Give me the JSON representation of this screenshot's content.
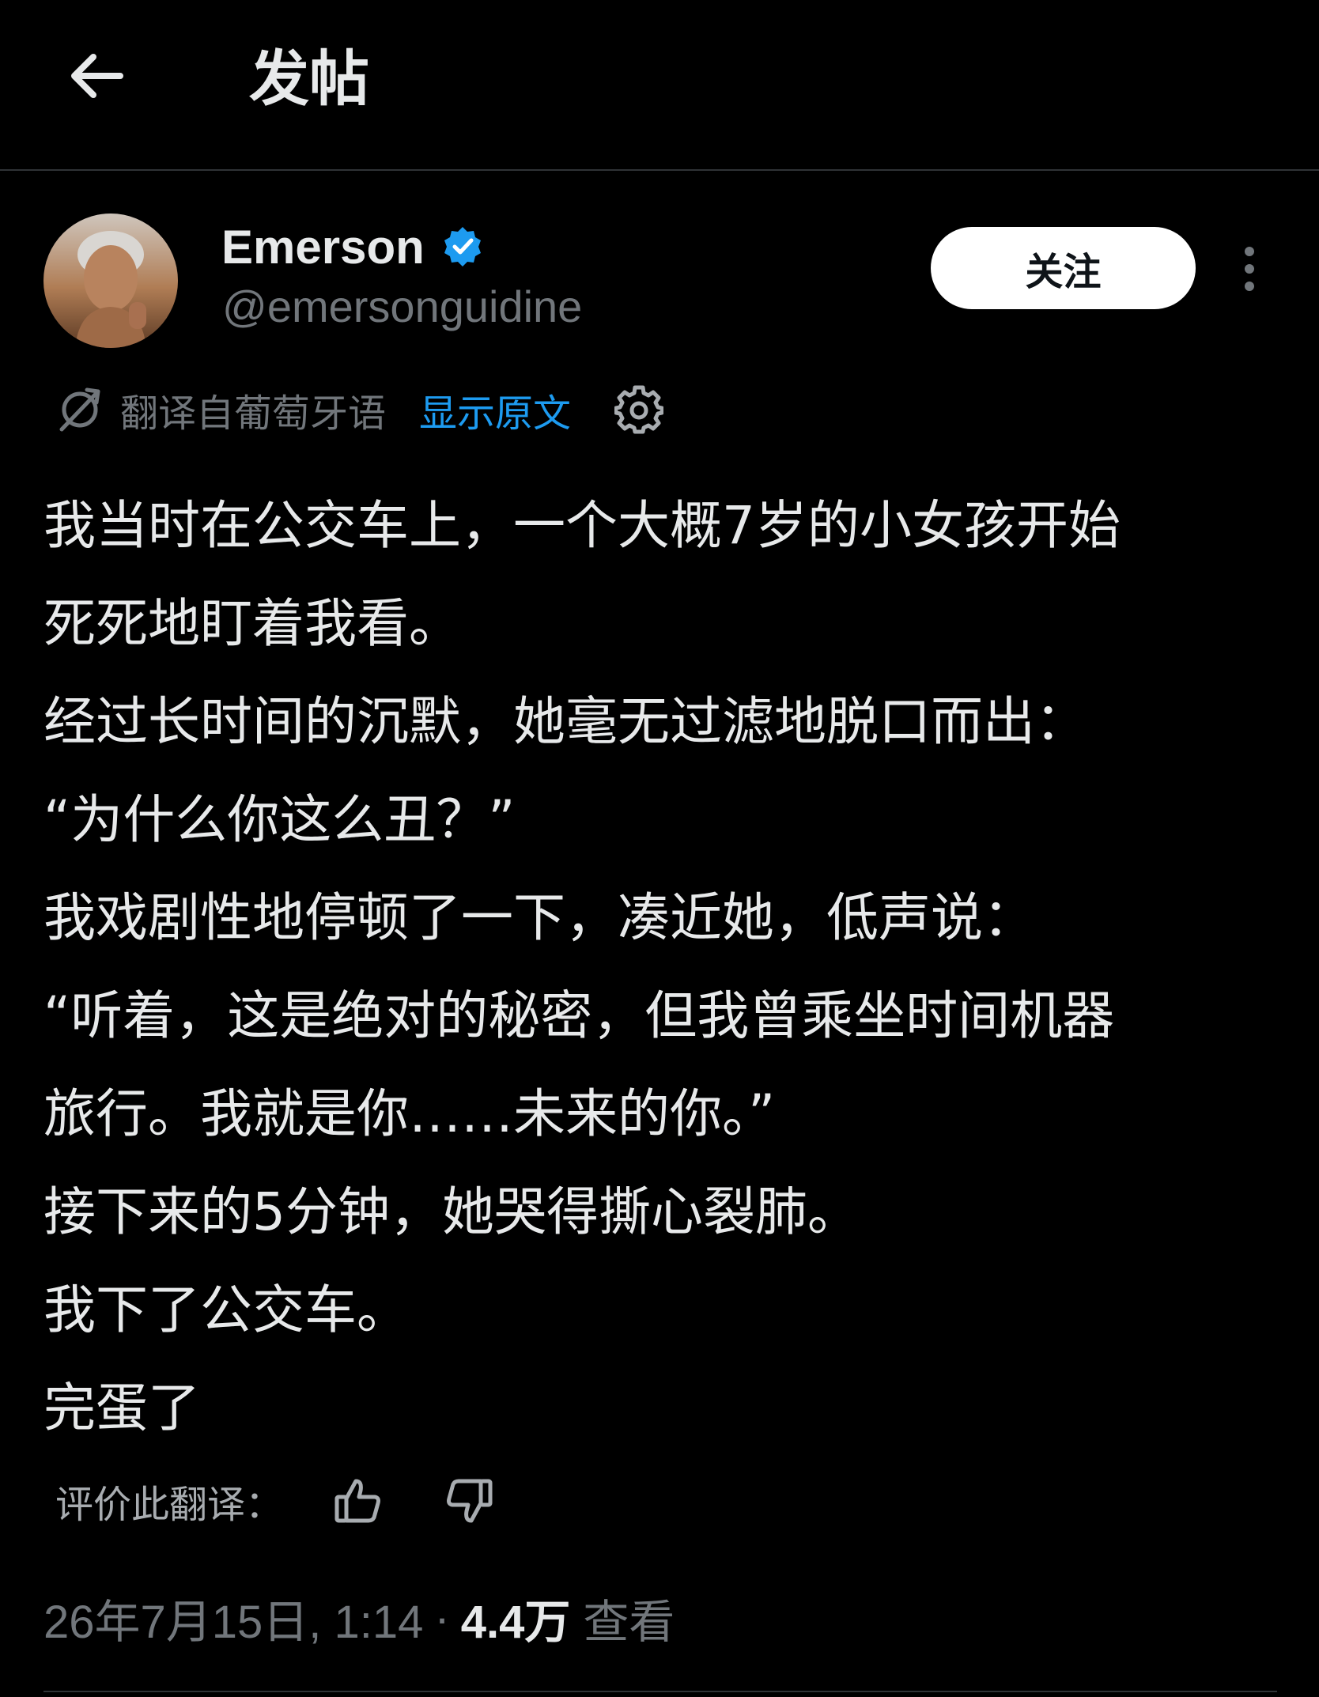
{
  "header": {
    "back_icon": "arrow-left-icon",
    "title": "发帖"
  },
  "author": {
    "display_name": "Emerson",
    "verified_icon": "verified-badge-icon",
    "handle": "@emersonguidine",
    "follow_label": "关注",
    "more_icon": "more-vertical-icon"
  },
  "translation": {
    "icon": "translate-icon",
    "notice": "翻译自葡萄牙语",
    "show_original_label": "显示原文",
    "settings_icon": "gear-icon"
  },
  "post": {
    "lines": [
      "我当时在公交车上，一个大概7岁的小女孩开始",
      "死死地盯着我看。",
      "经过长时间的沉默，她毫无过滤地脱口而出：",
      "“为什么你这么丑？”",
      "我戏剧性地停顿了一下，凑近她，低声说：",
      "“听着，这是绝对的秘密，但我曾乘坐时间机器",
      "旅行。我就是你……未来的你。”",
      "接下来的5分钟，她哭得撕心裂肺。",
      "我下了公交车。",
      "完蛋了"
    ]
  },
  "rating": {
    "label": "评价此翻译：",
    "thumbs_up_icon": "thumbs-up-icon",
    "thumbs_down_icon": "thumbs-down-icon"
  },
  "meta": {
    "timestamp": "26年7月15日, 1:14",
    "separator": "·",
    "views_count": "4.4万",
    "views_label": "查看"
  },
  "colors": {
    "background": "#000000",
    "text_primary": "#e7e9ea",
    "text_secondary": "#71767b",
    "accent": "#1d9bf0",
    "divider": "#2f3336"
  }
}
